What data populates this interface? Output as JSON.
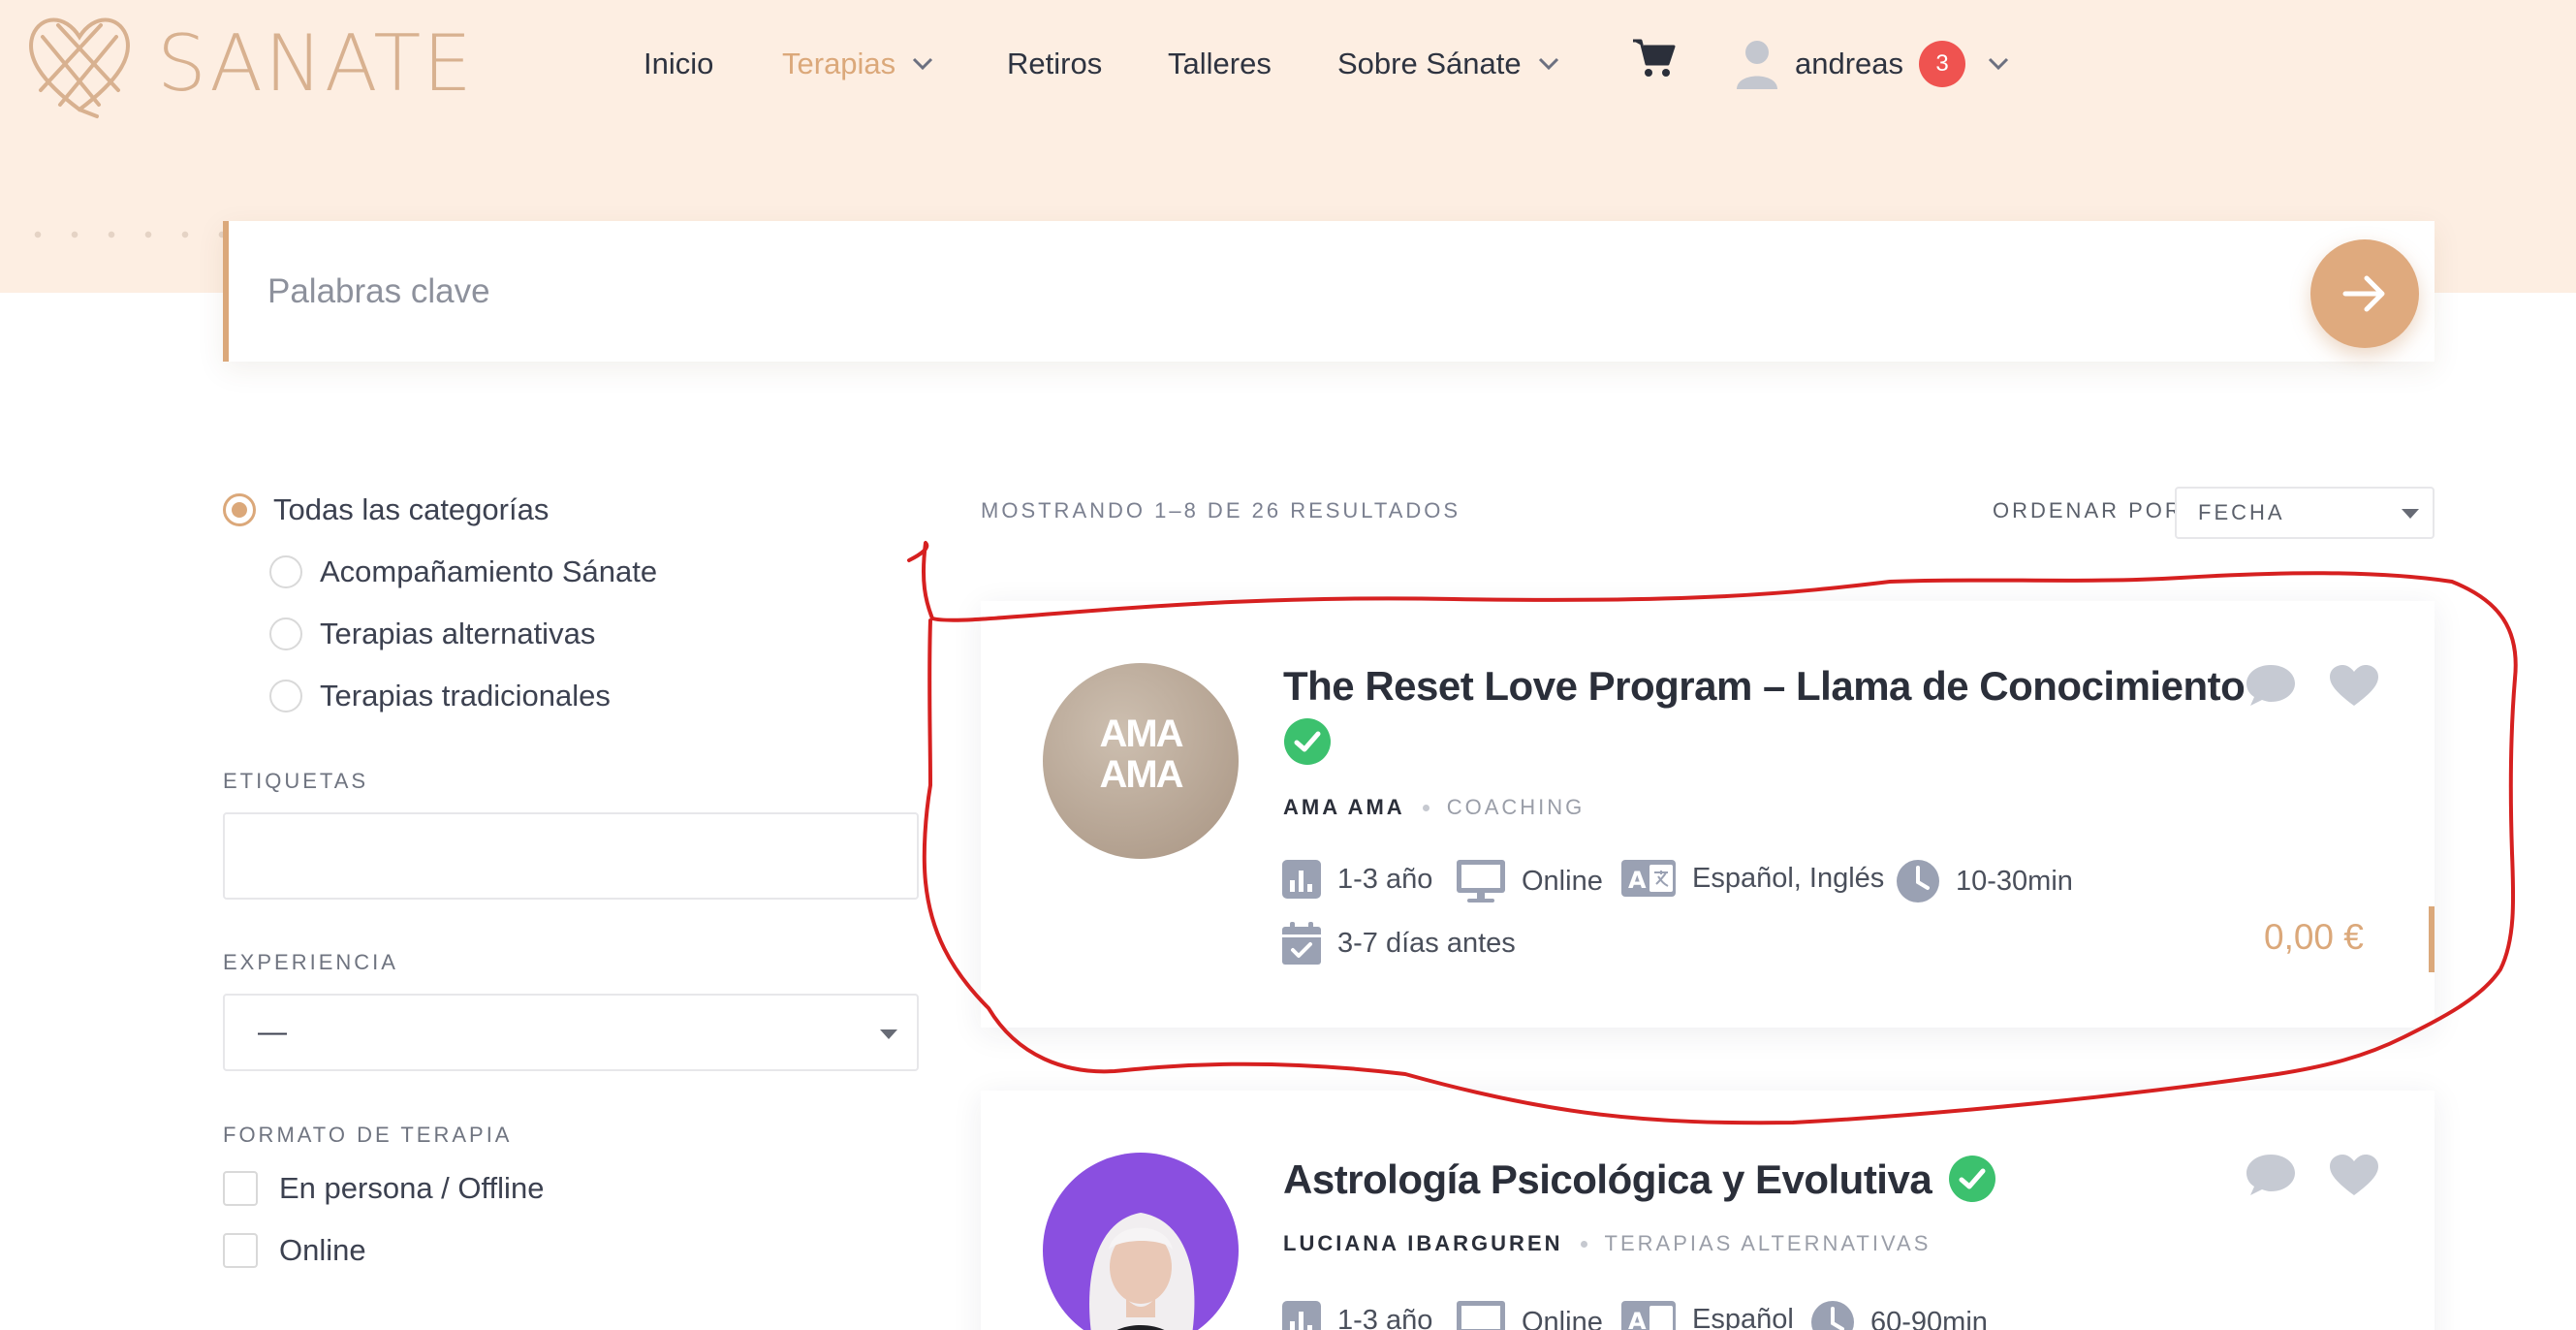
{
  "brand": {
    "name": "SANATE",
    "logo_icon": "heart-knot-icon"
  },
  "nav": {
    "items": [
      {
        "label": "Inicio",
        "active": false,
        "dropdown": false
      },
      {
        "label": "Terapias",
        "active": true,
        "dropdown": true
      },
      {
        "label": "Retiros",
        "active": false,
        "dropdown": false
      },
      {
        "label": "Talleres",
        "active": false,
        "dropdown": false
      },
      {
        "label": "Sobre Sánate",
        "active": false,
        "dropdown": true
      }
    ],
    "cart_icon": "shopping-cart-icon",
    "user": {
      "name": "andreas",
      "notifications": "3"
    }
  },
  "search": {
    "placeholder": "Palabras clave"
  },
  "sidebar": {
    "categories": [
      {
        "label": "Todas las categorías",
        "selected": true
      },
      {
        "label": "Acompañamiento Sánate",
        "selected": false
      },
      {
        "label": "Terapias alternativas",
        "selected": false
      },
      {
        "label": "Terapias tradicionales",
        "selected": false
      }
    ],
    "tags_label": "ETIQUETAS",
    "experience_label": "EXPERIENCIA",
    "experience_value": "—",
    "format_label": "FORMATO DE TERAPIA",
    "format_options": [
      "En persona / Offline",
      "Online"
    ]
  },
  "results": {
    "summary": "MOSTRANDO 1–8 DE 26 RESULTADOS",
    "order_label": "ORDENAR POR",
    "order_value": "FECHA"
  },
  "cards": [
    {
      "title_line1": "The Reset Love Program – Llama de Conocimiento",
      "avatar_text": "AMA AMA",
      "author": "AMA AMA",
      "category": "COACHING",
      "experience": "1-3 año",
      "format": "Online",
      "languages": "Español, Inglés",
      "duration": "10-30min",
      "booking": "3-7 días antes",
      "price": "0,00 €"
    },
    {
      "title_line1": "Astrología Psicológica y Evolutiva",
      "author": "LUCIANA IBARGUREN",
      "category": "TERAPIAS ALTERNATIVAS",
      "experience": "1-3 año",
      "format": "Online",
      "languages": "Español",
      "duration": "60-90min"
    }
  ],
  "colors": {
    "accent": "#dba87a",
    "header_bg": "#fdeee2",
    "verified": "#3cc16e",
    "badge": "#ef5350",
    "annotation": "#d62020"
  }
}
